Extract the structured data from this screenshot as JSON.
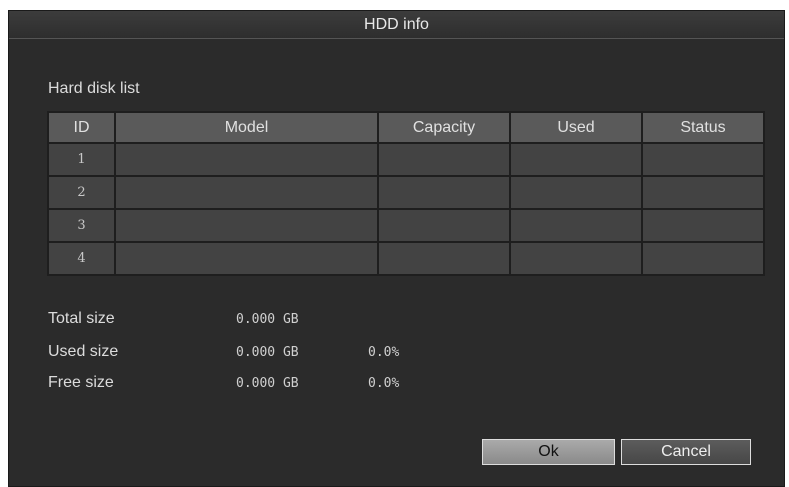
{
  "dialog": {
    "title": "HDD info"
  },
  "disk_list": {
    "label": "Hard disk list",
    "columns": [
      "ID",
      "Model",
      "Capacity",
      "Used",
      "Status"
    ],
    "rows": [
      {
        "id": "1",
        "model": "",
        "capacity": "",
        "used": "",
        "status": ""
      },
      {
        "id": "2",
        "model": "",
        "capacity": "",
        "used": "",
        "status": ""
      },
      {
        "id": "3",
        "model": "",
        "capacity": "",
        "used": "",
        "status": ""
      },
      {
        "id": "4",
        "model": "",
        "capacity": "",
        "used": "",
        "status": ""
      }
    ]
  },
  "summary": {
    "total": {
      "label": "Total size",
      "value": "0.000 GB",
      "percent": ""
    },
    "used": {
      "label": "Used size",
      "value": "0.000 GB",
      "percent": "0.0%"
    },
    "free": {
      "label": "Free size",
      "value": "0.000 GB",
      "percent": "0.0%"
    }
  },
  "buttons": {
    "ok_label": "Ok",
    "cancel_label": "Cancel"
  },
  "colors": {
    "window_bg": "#2b2b2b",
    "header_bg": "#5a5a5a",
    "cell_bg": "#434343"
  }
}
